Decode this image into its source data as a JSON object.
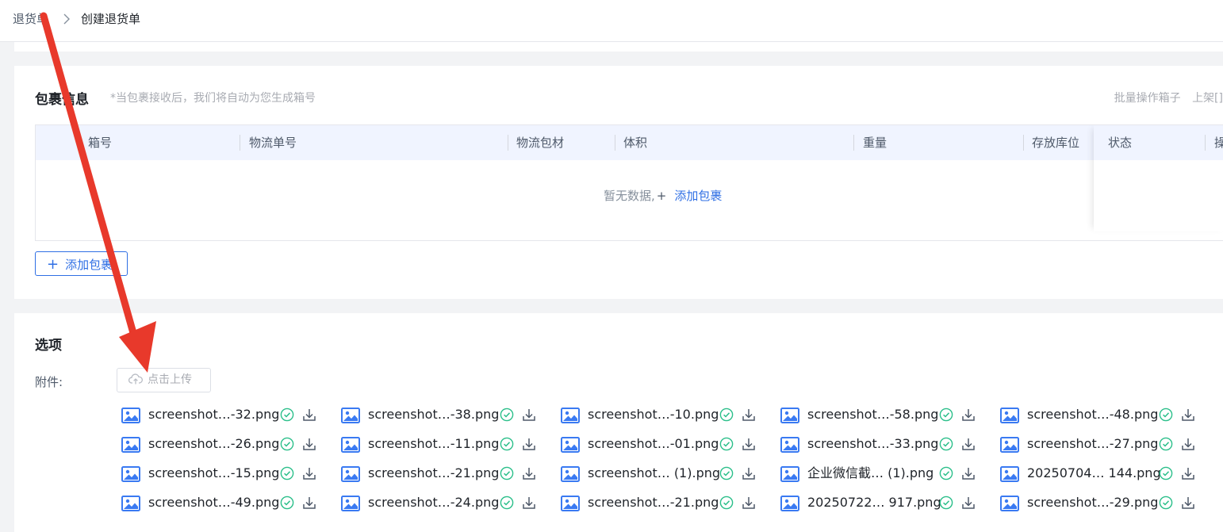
{
  "breadcrumb": {
    "root": "退货单",
    "current": "创建退货单"
  },
  "package_section": {
    "title": "包裹信息",
    "note": "*当包裹接收后，我们将自动为您生成箱号",
    "actions": [
      "批量操作箱子",
      "上架[]"
    ],
    "columns": [
      "箱号",
      "物流单号",
      "物流包材",
      "体积",
      "重量",
      "存放库位",
      "状态",
      "操"
    ],
    "empty_text": "暂无数据,",
    "empty_plus": "+",
    "empty_link": "添加包裹",
    "add_button": "添加包裹"
  },
  "options_section": {
    "title": "选项",
    "attach_label": "附件:",
    "upload_button": "点击上传",
    "files": [
      "screenshot…-32.png",
      "screenshot…-38.png",
      "screenshot…-10.png",
      "screenshot…-58.png",
      "screenshot…-48.png",
      "screenshot…-26.png",
      "screenshot…-11.png",
      "screenshot…-01.png",
      "screenshot…-33.png",
      "screenshot…-27.png",
      "screenshot…-15.png",
      "screenshot…-21.png",
      "screenshot… (1).png",
      "企业微信截… (1).png",
      "20250704… 144.png",
      "screenshot…-49.png",
      "screenshot…-24.png",
      "screenshot…-21.png",
      "20250722… 917.png",
      "screenshot…-29.png"
    ]
  },
  "colors": {
    "primary": "#2f6fe4",
    "success": "#2bbf8a",
    "annotation": "#e8392b"
  }
}
